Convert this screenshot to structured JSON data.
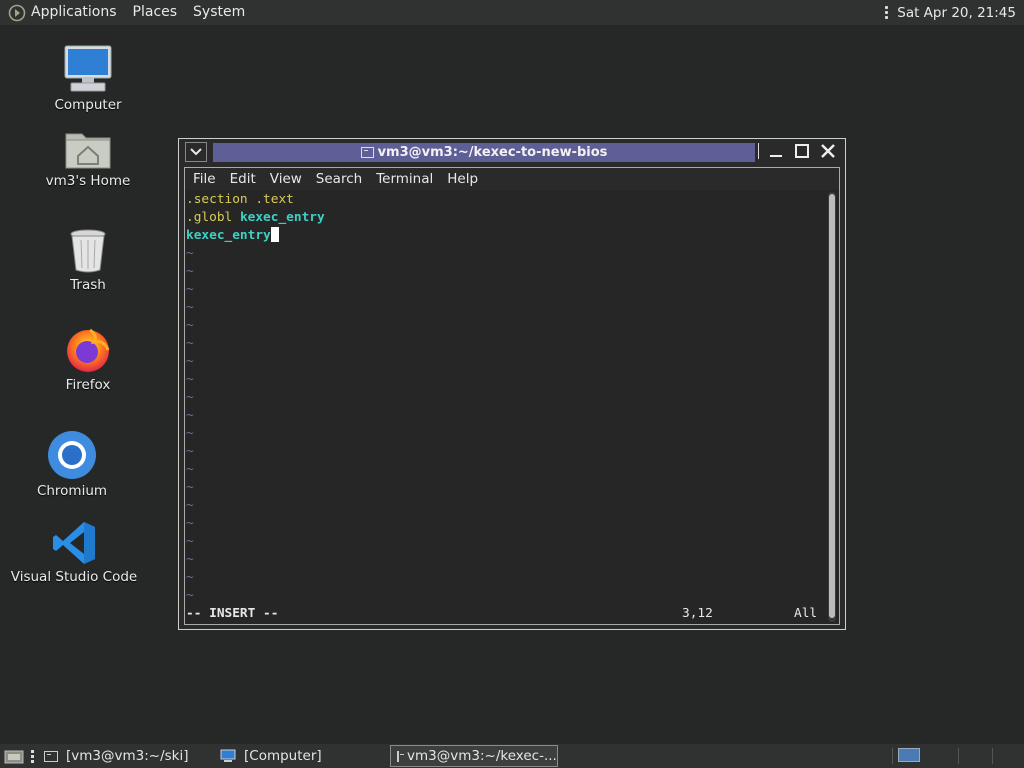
{
  "top_panel": {
    "applications": "Applications",
    "places": "Places",
    "system": "System",
    "clock": "Sat Apr 20, 21:45"
  },
  "desktop_icons": [
    {
      "label": "Computer",
      "icon": "computer-icon"
    },
    {
      "label": "vm3's Home",
      "icon": "home-folder-icon"
    },
    {
      "label": "Trash",
      "icon": "trash-icon"
    },
    {
      "label": "Firefox",
      "icon": "firefox-icon"
    },
    {
      "label": "Chromium",
      "icon": "chromium-icon"
    },
    {
      "label": "Visual Studio Code",
      "icon": "vscode-icon"
    }
  ],
  "window": {
    "title": "vm3@vm3:~/kexec-to-new-bios",
    "menu": [
      "File",
      "Edit",
      "View",
      "Search",
      "Terminal",
      "Help"
    ]
  },
  "editor": {
    "line1": ".section .text",
    "line2_a": ".globl ",
    "line2_b": "kexec_entry",
    "line3": "kexec_entry",
    "tilde": "~",
    "mode": "-- INSERT --",
    "position": "3,12",
    "percent": "All"
  },
  "taskbar": [
    {
      "label": "[vm3@vm3:~/ski]"
    },
    {
      "label": "[Computer]"
    },
    {
      "label": "vm3@vm3:~/kexec-..."
    }
  ],
  "colors": {
    "title_strip": "#5f5f98",
    "syntax_yellow": "#d8cc55",
    "syntax_cyan": "#3fd0c4",
    "tilde": "#6d6d9a"
  }
}
